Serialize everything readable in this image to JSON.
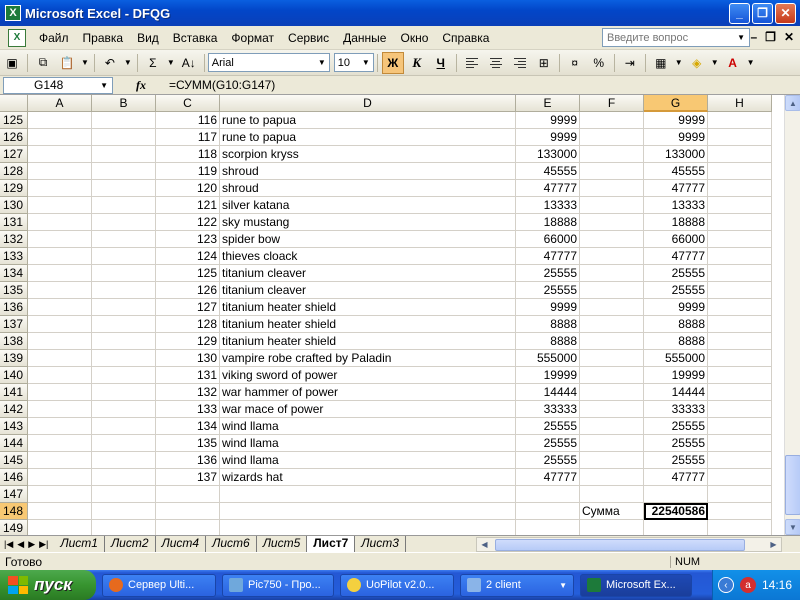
{
  "window": {
    "title": "Microsoft Excel - DFQG"
  },
  "menu": {
    "items": [
      "Файл",
      "Правка",
      "Вид",
      "Вставка",
      "Формат",
      "Сервис",
      "Данные",
      "Окно",
      "Справка"
    ],
    "help_placeholder": "Введите вопрос"
  },
  "toolbar": {
    "font_name": "Arial",
    "font_size": "10",
    "bold": "Ж",
    "italic": "К",
    "underline": "Ч",
    "sum": "Σ",
    "percent": "%"
  },
  "formula_bar": {
    "cell_ref": "G148",
    "fx": "fx",
    "formula": "=СУММ(G10:G147)"
  },
  "columns": [
    "A",
    "B",
    "C",
    "D",
    "E",
    "F",
    "G",
    "H"
  ],
  "selected_column": "G",
  "rows": [
    {
      "row": "125",
      "c": "116",
      "d": "rune to papua",
      "e": "9999",
      "f": "",
      "g": "9999"
    },
    {
      "row": "126",
      "c": "117",
      "d": "rune to papua",
      "e": "9999",
      "f": "",
      "g": "9999"
    },
    {
      "row": "127",
      "c": "118",
      "d": "scorpion kryss",
      "e": "133000",
      "f": "",
      "g": "133000"
    },
    {
      "row": "128",
      "c": "119",
      "d": "shroud",
      "e": "45555",
      "f": "",
      "g": "45555"
    },
    {
      "row": "129",
      "c": "120",
      "d": "shroud",
      "e": "47777",
      "f": "",
      "g": "47777"
    },
    {
      "row": "130",
      "c": "121",
      "d": "silver katana",
      "e": "13333",
      "f": "",
      "g": "13333"
    },
    {
      "row": "131",
      "c": "122",
      "d": "sky mustang",
      "e": "18888",
      "f": "",
      "g": "18888"
    },
    {
      "row": "132",
      "c": "123",
      "d": "spider bow",
      "e": "66000",
      "f": "",
      "g": "66000"
    },
    {
      "row": "133",
      "c": "124",
      "d": "thieves cloack",
      "e": "47777",
      "f": "",
      "g": "47777"
    },
    {
      "row": "134",
      "c": "125",
      "d": "titanium cleaver",
      "e": "25555",
      "f": "",
      "g": "25555"
    },
    {
      "row": "135",
      "c": "126",
      "d": "titanium cleaver",
      "e": "25555",
      "f": "",
      "g": "25555"
    },
    {
      "row": "136",
      "c": "127",
      "d": "titanium heater shield",
      "e": "9999",
      "f": "",
      "g": "9999"
    },
    {
      "row": "137",
      "c": "128",
      "d": "titanium heater shield",
      "e": "8888",
      "f": "",
      "g": "8888"
    },
    {
      "row": "138",
      "c": "129",
      "d": "titanium heater shield",
      "e": "8888",
      "f": "",
      "g": "8888"
    },
    {
      "row": "139",
      "c": "130",
      "d": "vampire robe crafted by Paladin",
      "e": "555000",
      "f": "",
      "g": "555000"
    },
    {
      "row": "140",
      "c": "131",
      "d": "viking sword of power",
      "e": "19999",
      "f": "",
      "g": "19999"
    },
    {
      "row": "141",
      "c": "132",
      "d": "war hammer of power",
      "e": "14444",
      "f": "",
      "g": "14444"
    },
    {
      "row": "142",
      "c": "133",
      "d": "war mace of power",
      "e": "33333",
      "f": "",
      "g": "33333"
    },
    {
      "row": "143",
      "c": "134",
      "d": "wind llama",
      "e": "25555",
      "f": "",
      "g": "25555"
    },
    {
      "row": "144",
      "c": "135",
      "d": "wind llama",
      "e": "25555",
      "f": "",
      "g": "25555"
    },
    {
      "row": "145",
      "c": "136",
      "d": "wind llama",
      "e": "25555",
      "f": "",
      "g": "25555"
    },
    {
      "row": "146",
      "c": "137",
      "d": "wizards hat",
      "e": "47777",
      "f": "",
      "g": "47777"
    },
    {
      "row": "147",
      "c": "",
      "d": "",
      "e": "",
      "f": "",
      "g": ""
    },
    {
      "row": "148",
      "c": "",
      "d": "",
      "e": "",
      "f": "Сумма",
      "g": "22540586",
      "active": true
    },
    {
      "row": "149",
      "c": "",
      "d": "",
      "e": "",
      "f": "",
      "g": ""
    }
  ],
  "sheets": [
    "Лист1",
    "Лист2",
    "Лист4",
    "Лист6",
    "Лист5",
    "Лист7",
    "Лист3"
  ],
  "active_sheet": "Лист7",
  "status": {
    "text": "Готово",
    "num": "NUM"
  },
  "taskbar": {
    "start": "пуск",
    "tasks": [
      "Сервер Ulti...",
      "Pic750 - Про...",
      "UoPilot  v2.0...",
      "2 client",
      "Microsoft Ex..."
    ],
    "active_task": 4,
    "clock": "14:16"
  },
  "colors": {
    "accent": "#0a5fe0",
    "selected_header": "#f8c873",
    "start_green": "#37942f"
  }
}
